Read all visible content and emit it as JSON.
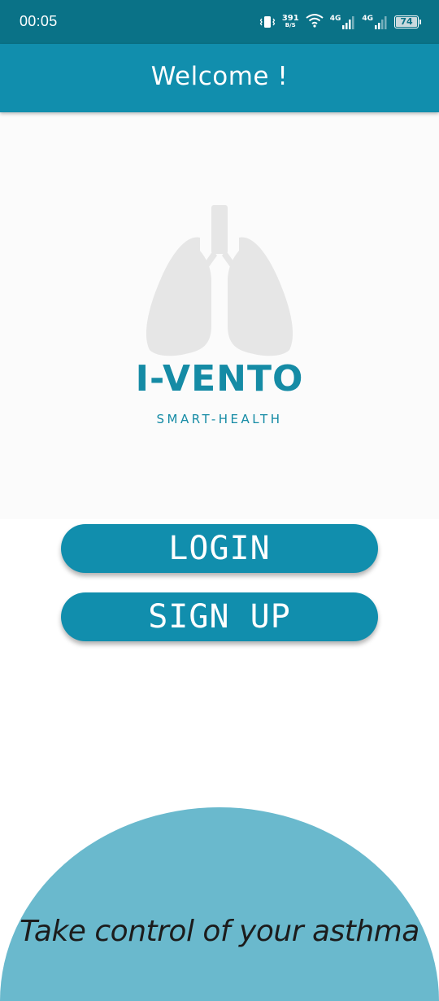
{
  "status_bar": {
    "time": "00:05",
    "net_speed_value": "391",
    "net_speed_unit": "B/S",
    "signal_1_label": "4G",
    "signal_2_label": "4G",
    "battery_level": "74",
    "icons": [
      "vibrate-icon",
      "wifi-icon",
      "signal-icon",
      "battery-icon"
    ]
  },
  "app_bar": {
    "title": "Welcome !"
  },
  "logo": {
    "wordmark": "I-VENTO",
    "tagline": "SMART-HEALTH",
    "icon": "lungs-icon"
  },
  "actions": {
    "login_label": "LOGIN",
    "signup_label": "SIGN UP"
  },
  "footer": {
    "tagline": "Take control of your asthma"
  },
  "colors": {
    "status_bar": "#0a7287",
    "primary": "#118ead",
    "brand_text": "#158ba5",
    "accent_light": "#6ab9cd",
    "logo_gray": "#e6e6e6"
  }
}
